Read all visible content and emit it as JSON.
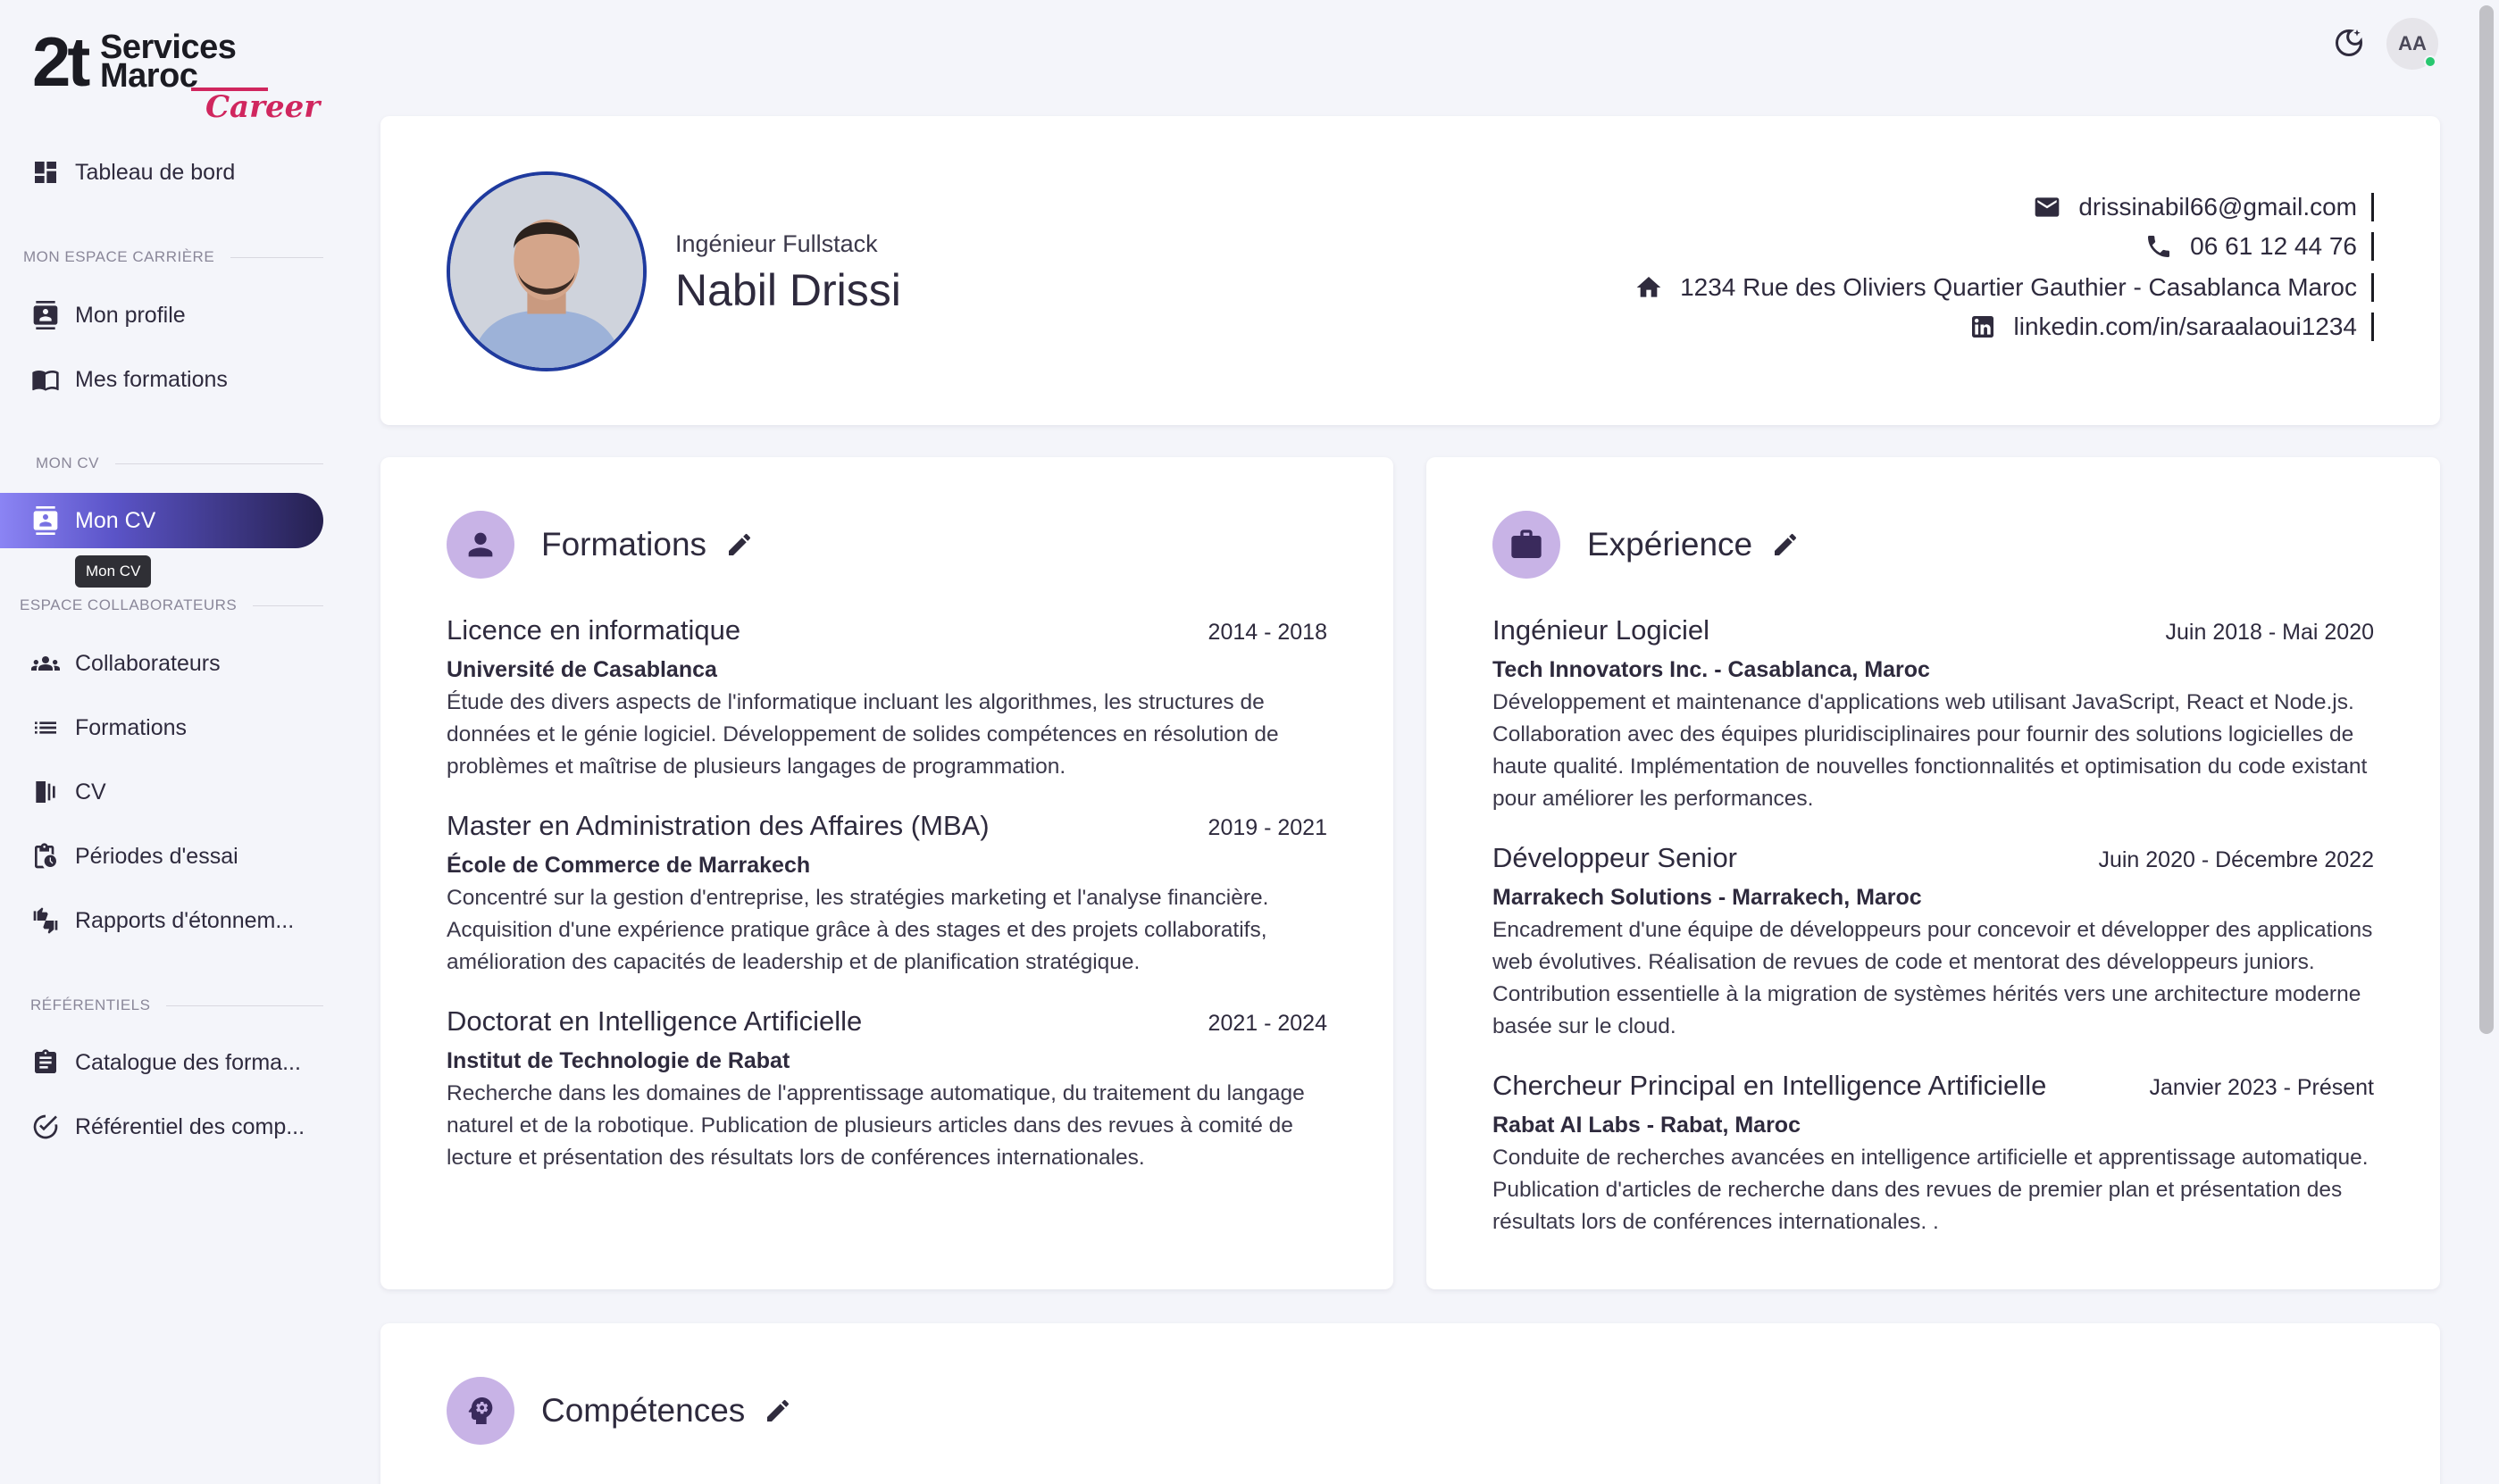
{
  "brand": {
    "mark": "2t",
    "line1": "Services",
    "line2": "Maroc",
    "tagline": "Career"
  },
  "sidebar": {
    "items": [
      {
        "label": "Tableau de bord",
        "icon": "dashboard-icon"
      },
      {
        "label": "Mon profile",
        "icon": "profile-card-icon"
      },
      {
        "label": "Mes formations",
        "icon": "book-open-icon"
      },
      {
        "label": "Mon CV",
        "icon": "cv-icon"
      },
      {
        "label": "Collaborateurs",
        "icon": "group-icon"
      },
      {
        "label": "Formations",
        "icon": "list-icon"
      },
      {
        "label": "CV",
        "icon": "documents-icon"
      },
      {
        "label": "Périodes d'essai",
        "icon": "clipboard-clock-icon"
      },
      {
        "label": "Rapports d'étonnem...",
        "icon": "thumbs-icon"
      },
      {
        "label": "Catalogue des forma...",
        "icon": "clipboard-list-icon"
      },
      {
        "label": "Référentiel des comp...",
        "icon": "check-circle-icon"
      }
    ],
    "sections": {
      "career": "MON ESPACE CARRIÈRE",
      "cv": "MON CV",
      "collaborators": "ESPACE COLLABORATEURS",
      "referentials": "RÉFÉRENTIELS"
    },
    "active_item": "Mon CV",
    "tooltip": "Mon CV"
  },
  "header": {
    "avatar_initials": "AA",
    "status_color": "#28c76f"
  },
  "profile": {
    "job_title": "Ingénieur Fullstack",
    "name": "Nabil Drissi",
    "email": "drissinabil66@gmail.com",
    "phone": "06 61 12 44 76",
    "address": "1234 Rue des Oliviers Quartier Gauthier - Casablanca Maroc",
    "linkedin": "linkedin.com/in/saraalaoui1234"
  },
  "formations": {
    "title": "Formations",
    "entries": [
      {
        "title": "Licence en informatique",
        "dates": "2014 - 2018",
        "org": "Université de Casablanca",
        "desc": "Étude des divers aspects de l'informatique incluant les algorithmes, les structures de données et le génie logiciel. Développement de solides compétences en résolution de problèmes et maîtrise de plusieurs langages de programmation."
      },
      {
        "title": "Master en Administration des Affaires (MBA)",
        "dates": "2019 - 2021",
        "org": "École de Commerce de Marrakech",
        "desc": "Concentré sur la gestion d'entreprise, les stratégies marketing et l'analyse financière. Acquisition d'une expérience pratique grâce à des stages et des projets collaboratifs, amélioration des capacités de leadership et de planification stratégique."
      },
      {
        "title": "Doctorat en Intelligence Artificielle",
        "dates": "2021 - 2024",
        "org": "Institut de Technologie de Rabat",
        "desc": "Recherche dans les domaines de l'apprentissage automatique, du traitement du langage naturel et de la robotique. Publication de plusieurs articles dans des revues à comité de lecture et présentation des résultats lors de conférences internationales."
      }
    ]
  },
  "experience": {
    "title": "Expérience",
    "entries": [
      {
        "title": "Ingénieur Logiciel",
        "dates": "Juin 2018 - Mai 2020",
        "org": "Tech Innovators Inc. - Casablanca, Maroc",
        "desc": "Développement et maintenance d'applications web utilisant JavaScript, React et Node.js. Collaboration avec des équipes pluridisciplinaires pour fournir des solutions logicielles de haute qualité. Implémentation de nouvelles fonctionnalités et optimisation du code existant pour améliorer les performances."
      },
      {
        "title": "Développeur Senior",
        "dates": "Juin 2020 - Décembre 2022",
        "org": "Marrakech Solutions - Marrakech, Maroc",
        "desc": "Encadrement d'une équipe de développeurs pour concevoir et développer des applications web évolutives. Réalisation de revues de code et mentorat des développeurs juniors. Contribution essentielle à la migration de systèmes hérités vers une architecture moderne basée sur le cloud."
      },
      {
        "title": "Chercheur Principal en Intelligence Artificielle",
        "dates": "Janvier 2023 - Présent",
        "org": "Rabat AI Labs - Rabat, Maroc",
        "desc": "Conduite de recherches avancées en intelligence artificielle et apprentissage automatique. Publication d'articles de recherche dans des revues de premier plan et présentation des résultats lors de conférences internationales. ."
      }
    ]
  },
  "skills": {
    "title": "Compétences"
  },
  "colors": {
    "accent": "#5b54c8",
    "badge": "#c8b3e6",
    "logo_accent": "#d0265e"
  }
}
